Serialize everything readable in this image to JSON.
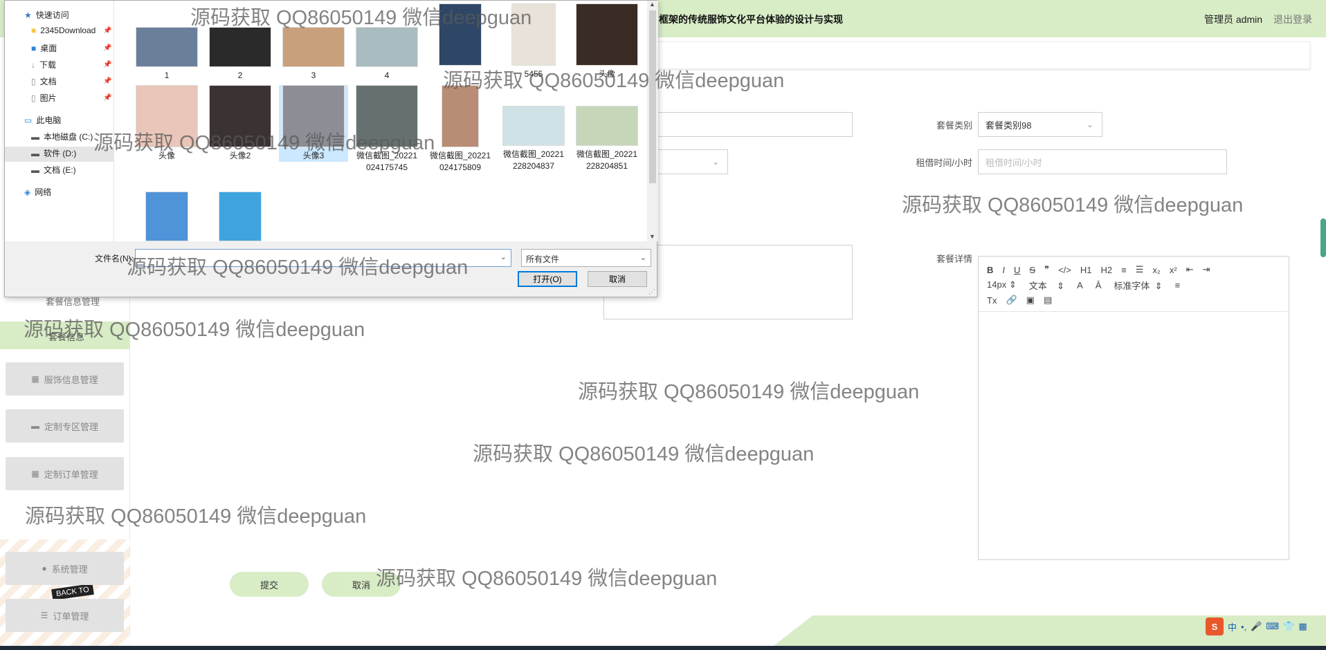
{
  "header": {
    "title": "框架的传统服饰文化平台体验的设计与实现",
    "user": "管理员 admin",
    "logout": "退出登录"
  },
  "sidebar": {
    "faded_items": [
      "套餐信息管理",
      "套餐信息"
    ],
    "items": [
      {
        "label": "服饰信息管理",
        "icon": "grid-icon"
      },
      {
        "label": "定制专区管理",
        "icon": "monitor-icon"
      },
      {
        "label": "定制订单管理",
        "icon": "grid-icon"
      },
      {
        "label": "系统管理",
        "icon": "pin-icon"
      },
      {
        "label": "订单管理",
        "icon": "list-icon"
      }
    ],
    "deco_text": "BACK TO"
  },
  "form": {
    "category_label": "套餐类别",
    "category_value": "套餐类别98",
    "rent_label": "租借时间/小时",
    "rent_placeholder": "租借时间/小时",
    "detail_label": "套餐详情",
    "submit": "提交",
    "cancel": "取消"
  },
  "editor": {
    "fontsize": "14px",
    "format": "文本",
    "fontfamily": "标准字体",
    "toolbar_row1": [
      "B",
      "I",
      "U",
      "S",
      "❞",
      "</>",
      "H1",
      "H2",
      "≡",
      "☰",
      "x₂",
      "x²",
      "⇤",
      "⇥"
    ],
    "toolbar_row2_icons": [
      "A",
      "Ā",
      "≡"
    ],
    "toolbar_row3": [
      "Tx",
      "🔗",
      "▣",
      "▤"
    ]
  },
  "dialog": {
    "nav": [
      {
        "label": "快速访问",
        "icon": "star-icon",
        "color": "#2f7ad9"
      },
      {
        "label": "2345Download",
        "icon": "folder-icon",
        "color": "#f3c744",
        "pinned": true
      },
      {
        "label": "桌面",
        "icon": "desktop-icon",
        "color": "#2b87d8",
        "pinned": true
      },
      {
        "label": "下载",
        "icon": "download-icon",
        "color": "#888",
        "pinned": true
      },
      {
        "label": "文档",
        "icon": "document-icon",
        "color": "#888",
        "pinned": true
      },
      {
        "label": "图片",
        "icon": "picture-icon",
        "color": "#888",
        "pinned": true
      },
      {
        "label": "此电脑",
        "icon": "pc-icon",
        "color": "#2b87d8"
      },
      {
        "label": "本地磁盘 (C:)",
        "icon": "drive-icon",
        "color": "#555"
      },
      {
        "label": "软件 (D:)",
        "icon": "drive-icon",
        "color": "#555"
      },
      {
        "label": "文档 (E:)",
        "icon": "drive-icon",
        "color": "#555"
      },
      {
        "label": "网络",
        "icon": "network-icon",
        "color": "#2b87d8"
      }
    ],
    "files": [
      {
        "name": "1",
        "color": "#6a7f9a"
      },
      {
        "name": "2",
        "color": "#2a2a2a"
      },
      {
        "name": "3",
        "color": "#c9a07c"
      },
      {
        "name": "4",
        "color": "#a9bcc0"
      },
      {
        "name": "",
        "color": "#2f4766"
      },
      {
        "name": "5455",
        "color": "#e9e2d8"
      },
      {
        "name": "头像",
        "color": "#3a2b24"
      },
      {
        "name": "头像",
        "color": "#e9c6b9"
      },
      {
        "name": "头像2",
        "color": "#3a3332"
      },
      {
        "name": "头像3",
        "color": "#8c8d95"
      },
      {
        "name": "微信截图_20221024175745",
        "color": "#667071"
      },
      {
        "name": "微信截图_20221024175809",
        "color": "#b98d75"
      },
      {
        "name": "微信截图_20221228204837",
        "color": "#cfe3e6"
      },
      {
        "name": "微信截图_20221228204851",
        "color": "#c6d6b8"
      },
      {
        "name": "",
        "color": "#4f93d8"
      },
      {
        "name": "",
        "color": "#3fa3e0"
      }
    ],
    "filename_label": "文件名(N):",
    "filename_value": "",
    "filetype": "所有文件",
    "open": "打开(O)",
    "cancel": "取消"
  },
  "watermark": "源码获取 QQ86050149 微信deepguan",
  "ime": {
    "lang": "中"
  }
}
